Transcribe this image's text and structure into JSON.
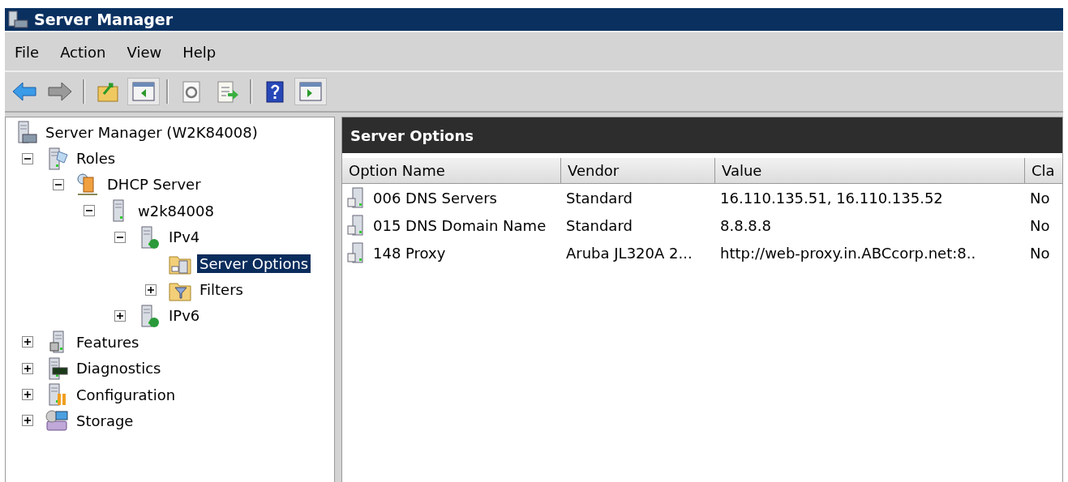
{
  "window": {
    "title": "Server Manager"
  },
  "menu": [
    "File",
    "Action",
    "View",
    "Help"
  ],
  "toolbar": [
    {
      "kind": "back",
      "pressed": false
    },
    {
      "kind": "forward",
      "pressed": false
    },
    {
      "kind": "sep"
    },
    {
      "kind": "up",
      "pressed": false
    },
    {
      "kind": "tree",
      "pressed": true
    },
    {
      "kind": "sep"
    },
    {
      "kind": "refresh",
      "pressed": false
    },
    {
      "kind": "export",
      "pressed": false
    },
    {
      "kind": "sep"
    },
    {
      "kind": "help",
      "pressed": false
    },
    {
      "kind": "actions",
      "pressed": true
    }
  ],
  "tree": [
    {
      "label": "Server Manager (W2K84008)",
      "kind": "console",
      "selected": false,
      "children": [
        {
          "label": "Roles",
          "kind": "roles",
          "expanded": true,
          "selected": false,
          "children": [
            {
              "label": "DHCP Server",
              "kind": "dhcp",
              "expanded": true,
              "selected": false,
              "children": [
                {
                  "label": "w2k84008",
                  "kind": "server",
                  "expanded": true,
                  "selected": false,
                  "children": [
                    {
                      "label": "IPv4",
                      "kind": "network",
                      "expanded": true,
                      "selected": false,
                      "children": [
                        {
                          "label": "Server Options",
                          "kind": "options",
                          "selected": true
                        },
                        {
                          "label": "Filters",
                          "kind": "filter",
                          "expanded": false,
                          "selected": false
                        }
                      ]
                    },
                    {
                      "label": "IPv6",
                      "kind": "network",
                      "expanded": false,
                      "selected": false
                    }
                  ]
                }
              ]
            }
          ]
        },
        {
          "label": "Features",
          "kind": "features",
          "expanded": false,
          "selected": false
        },
        {
          "label": "Diagnostics",
          "kind": "diagnostics",
          "expanded": false,
          "selected": false
        },
        {
          "label": "Configuration",
          "kind": "configuration",
          "expanded": false,
          "selected": false
        },
        {
          "label": "Storage",
          "kind": "storage",
          "expanded": false,
          "selected": false
        }
      ]
    }
  ],
  "panel": {
    "title": "Server Options"
  },
  "table": {
    "columns": [
      "Option Name",
      "Vendor",
      "Value",
      "Cla"
    ],
    "rows": [
      [
        "006 DNS Servers",
        "Standard",
        "16.110.135.51, 16.110.135.52",
        "No"
      ],
      [
        "015 DNS Domain Name",
        "Standard",
        "8.8.8.8",
        "No"
      ],
      [
        "148 Proxy",
        "Aruba JL320A 2...",
        "http://web-proxy.in.ABCcorp.net:8..",
        "No"
      ]
    ]
  }
}
